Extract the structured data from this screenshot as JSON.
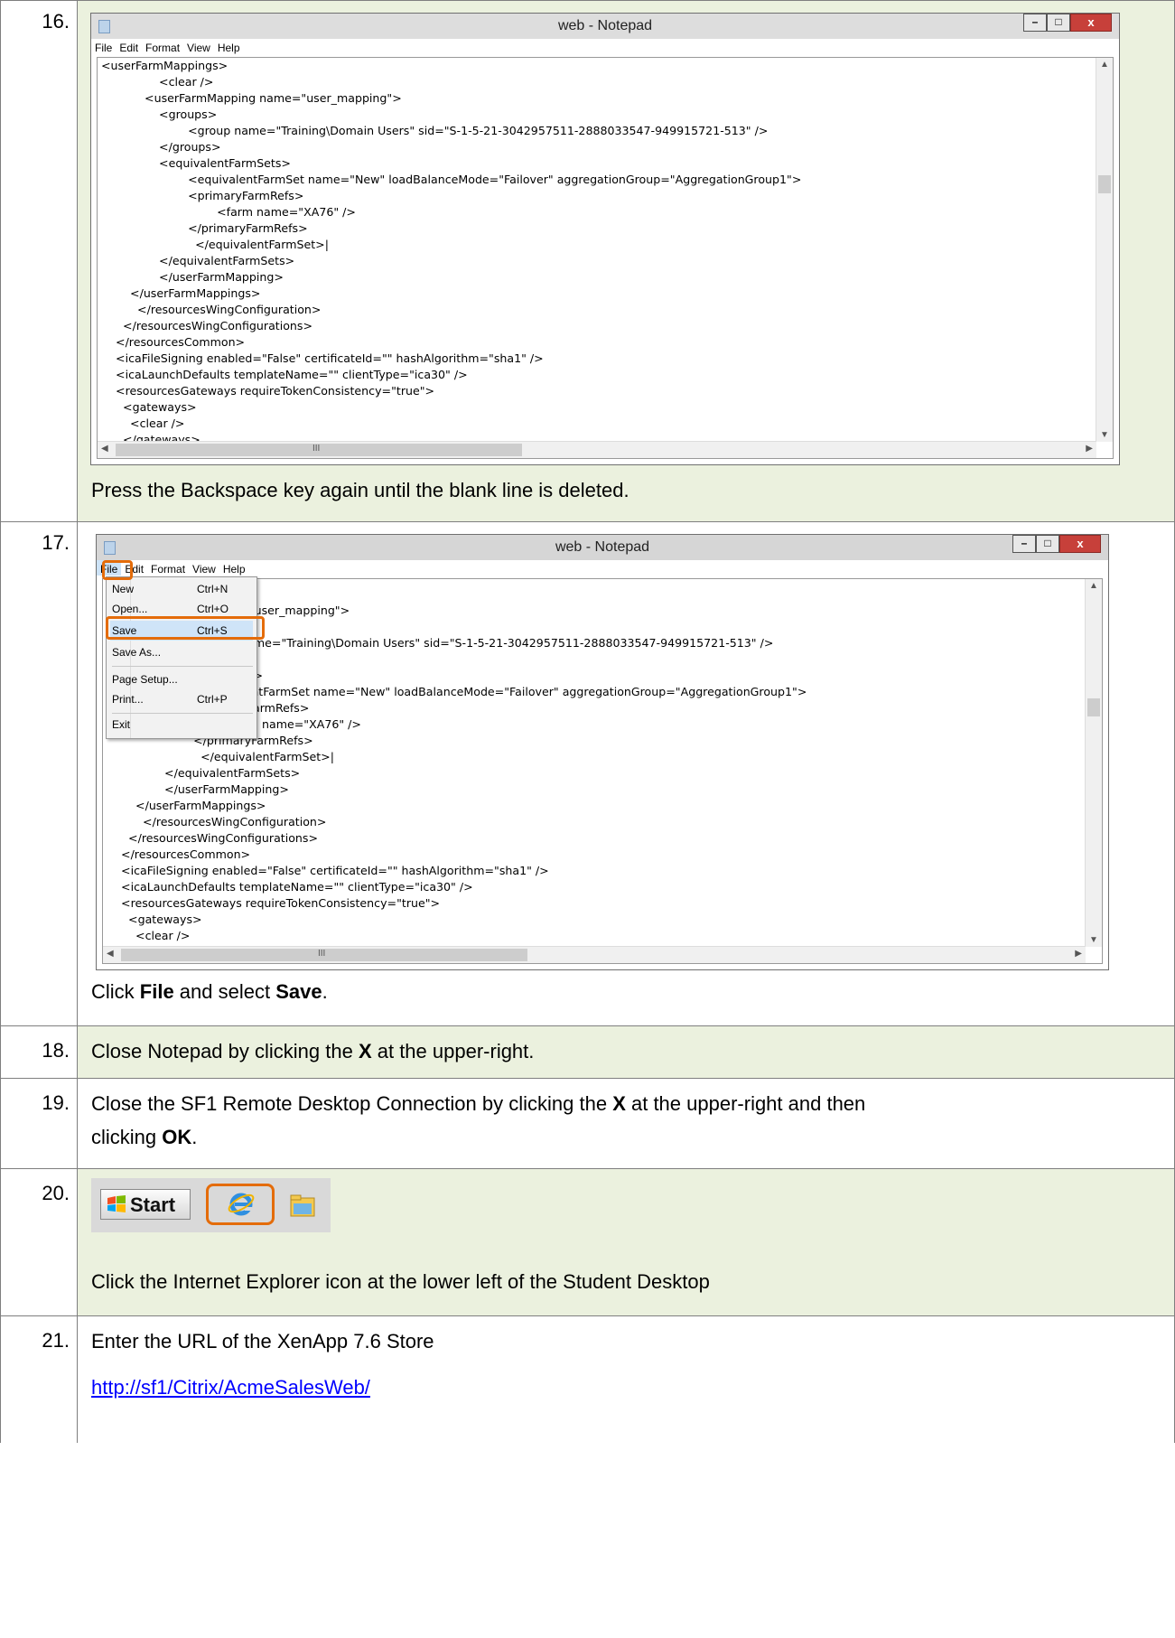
{
  "steps": [
    {
      "number": "16.",
      "caption": "Press the Backspace key again until the blank line is deleted."
    },
    {
      "number": "17.",
      "caption_pre": "Click ",
      "caption_b1": "File",
      "caption_mid": " and select ",
      "caption_b2": "Save",
      "caption_post": "."
    },
    {
      "number": "18.",
      "text_pre": "Close Notepad by clicking the ",
      "text_b": "X",
      "text_post": " at the upper-right."
    },
    {
      "number": "19.",
      "line1_pre": "Close the SF1 Remote Desktop Connection by clicking the ",
      "line1_b": "X",
      "line1_post": " at the upper-right and then",
      "line2_pre": "clicking ",
      "line2_b": "OK",
      "line2_post": "."
    },
    {
      "number": "20.",
      "caption": "Click the Internet Explorer icon at the lower left of the Student Desktop"
    },
    {
      "number": "21.",
      "line1": "Enter the URL of the XenApp 7.6 Store",
      "link": "http://sf1/Citrix/AcmeSalesWeb/"
    }
  ],
  "notepad": {
    "title": "web - Notepad",
    "menu": [
      "File",
      "Edit",
      "Format",
      "View",
      "Help"
    ],
    "minimize": "–",
    "maximize": "□",
    "close": "x",
    "code1": "<userFarmMappings>\n                <clear />\n            <userFarmMapping name=\"user_mapping\">\n                <groups>\n                        <group name=\"Training\\Domain Users\" sid=\"S-1-5-21-3042957511-2888033547-949915721-513\" />\n                </groups>\n                <equivalentFarmSets>\n                        <equivalentFarmSet name=\"New\" loadBalanceMode=\"Failover\" aggregationGroup=\"AggregationGroup1\">\n                        <primaryFarmRefs>\n                                <farm name=\"XA76\" />\n                        </primaryFarmRefs>\n                          </equivalentFarmSet>|\n                </equivalentFarmSets>\n                </userFarmMapping>\n        </userFarmMappings>\n          </resourcesWingConfiguration>\n      </resourcesWingConfigurations>\n    </resourcesCommon>\n    <icaFileSigning enabled=\"False\" certificateId=\"\" hashAlgorithm=\"sha1\" />\n    <icaLaunchDefaults templateName=\"\" clientType=\"ica30\" />\n    <resourcesGateways requireTokenConsistency=\"true\">\n      <gateways>\n        <clear />\n      </gateways>",
    "code2": "                    />\n                    ping name=\"user_mapping\">\n                    >\n                        <group name=\"Training\\Domain Users\" sid=\"S-1-5-21-3042957511-2888033547-949915721-513\" />\n                    s>\n                    lentFarmSets>\n                        <equivalentFarmSet name=\"New\" loadBalanceMode=\"Failover\" aggregationGroup=\"AggregationGroup1\">\n                        <primaryFarmRefs>\n                                <farm name=\"XA76\" />\n                        </primaryFarmRefs>\n                          </equivalentFarmSet>|\n                </equivalentFarmSets>\n                </userFarmMapping>\n        </userFarmMappings>\n          </resourcesWingConfiguration>\n      </resourcesWingConfigurations>\n    </resourcesCommon>\n    <icaFileSigning enabled=\"False\" certificateId=\"\" hashAlgorithm=\"sha1\" />\n    <icaLaunchDefaults templateName=\"\" clientType=\"ica30\" />\n    <resourcesGateways requireTokenConsistency=\"true\">\n      <gateways>\n        <clear />\n      </gateways>",
    "scroll_mark": "III"
  },
  "file_menu": {
    "items": [
      {
        "label": "New",
        "shortcut": "Ctrl+N"
      },
      {
        "label": "Open...",
        "shortcut": "Ctrl+O"
      },
      {
        "label": "Save",
        "shortcut": "Ctrl+S"
      },
      {
        "label": "Save As...",
        "shortcut": ""
      },
      {
        "label": "Page Setup...",
        "shortcut": ""
      },
      {
        "label": "Print...",
        "shortcut": "Ctrl+P"
      },
      {
        "label": "Exit",
        "shortcut": ""
      }
    ]
  },
  "taskbar": {
    "start_label": "Start"
  },
  "colors": {
    "row_green": "#ebf1de",
    "highlight": "#e46c0a",
    "link": "#0000ff"
  }
}
